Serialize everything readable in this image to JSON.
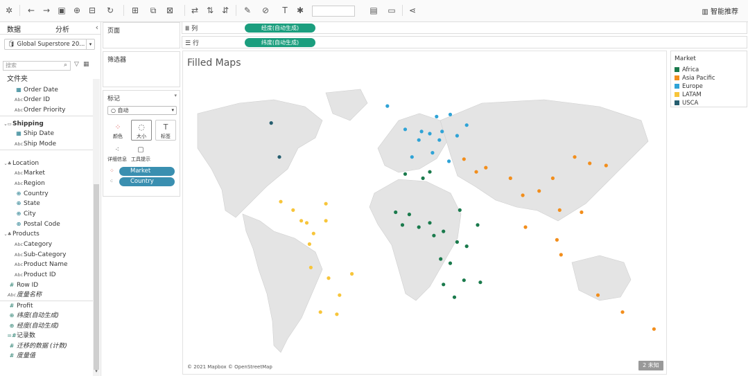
{
  "toolbar": {
    "icons": [
      "tableau-logo-icon",
      "undo-icon",
      "redo-icon",
      "save-icon",
      "new-datasource-icon",
      "pause-icon",
      "refresh-icon",
      "new-sheet-icon",
      "duplicate-icon",
      "clear-icon",
      "swap-icon",
      "sort-asc-icon",
      "sort-desc-icon",
      "highlight-icon",
      "group-icon",
      "label-icon",
      "fix-axes-icon",
      "fit-icon",
      "presentation-icon",
      "share-icon"
    ],
    "smart_label": "智能推荐"
  },
  "left_panel": {
    "tab_data": "数据",
    "tab_analytics": "分析",
    "datasource": "Global Superstore 20...",
    "search_placeholder": "搜索",
    "folder_label": "文件夹",
    "fields": [
      {
        "name": "Order Date",
        "type": "date",
        "indent": 1,
        "y": 0
      },
      {
        "name": "Order ID",
        "type": "abc",
        "indent": 1,
        "y": 14
      },
      {
        "name": "Order Priority",
        "type": "abc",
        "indent": 1,
        "y": 29
      }
    ],
    "shipping_group": "Shipping",
    "shipping_fields": [
      "Ship Date",
      "Ship Mode"
    ],
    "location_group": "Location",
    "location_fields": [
      "Market",
      "Region",
      "Country",
      "State",
      "City",
      "Postal Code"
    ],
    "products_group": "Products",
    "products_fields": [
      "Category",
      "Sub-Category",
      "Product Name",
      "Product ID"
    ],
    "row_id": "Row ID",
    "measure_names": "度量名称",
    "measures": [
      "Profit",
      "纬度(自动生成)",
      "经度(自动生成)",
      "记录数",
      "迁移的数据 (计数)",
      "度量值"
    ]
  },
  "cards": {
    "pages": "页面",
    "filters": "筛选器",
    "marks": "标记",
    "mark_type": "自动",
    "buttons": {
      "color": "颜色",
      "size": "大小",
      "label": "标签",
      "detail": "详细信息",
      "tooltip": "工具提示"
    },
    "pills": [
      "Market",
      "Country"
    ]
  },
  "shelves": {
    "columns_label": "列",
    "columns_pill": "经度(自动生成)",
    "rows_label": "行",
    "rows_pill": "纬度(自动生成)"
  },
  "viz": {
    "title": "Filled Maps",
    "attribution": "© 2021 Mapbox © OpenStreetMap",
    "unknown": "2 未知"
  },
  "legend": {
    "title": "Market",
    "items": [
      {
        "label": "Africa",
        "color": "#1a7a4c"
      },
      {
        "label": "Asia Pacific",
        "color": "#f28e1c"
      },
      {
        "label": "Europe",
        "color": "#2fa3d6"
      },
      {
        "label": "LATAM",
        "color": "#f7c53a"
      },
      {
        "label": "USCA",
        "color": "#265e6f"
      }
    ]
  },
  "chart_data": {
    "type": "scatter",
    "series": [
      {
        "name": "Africa",
        "points": [
          [
            -15,
            14
          ],
          [
            -5,
            13
          ],
          [
            2,
            7
          ],
          [
            10,
            9
          ],
          [
            20,
            5
          ],
          [
            30,
            0
          ],
          [
            37,
            -2
          ],
          [
            25,
            -10
          ],
          [
            20,
            -20
          ],
          [
            28,
            -26
          ],
          [
            32,
            15
          ],
          [
            45,
            8
          ],
          [
            5,
            30
          ],
          [
            10,
            33
          ],
          [
            -8,
            32
          ],
          [
            18,
            -8
          ],
          [
            35,
            -18
          ],
          [
            47,
            -19
          ],
          [
            -10,
            8
          ],
          [
            13,
            3
          ]
        ]
      },
      {
        "name": "Asia Pacific",
        "points": [
          [
            78,
            22
          ],
          [
            105,
            15
          ],
          [
            116,
            40
          ],
          [
            139,
            36
          ],
          [
            127,
            37
          ],
          [
            103,
            1
          ],
          [
            121,
            14
          ],
          [
            106,
            -6
          ],
          [
            133,
            -25
          ],
          [
            151,
            -33
          ],
          [
            174,
            -41
          ],
          [
            69,
            30
          ],
          [
            90,
            24
          ],
          [
            80,
            7
          ],
          [
            51,
            35
          ],
          [
            44,
            33
          ],
          [
            35,
            39
          ],
          [
            100,
            30
          ]
        ]
      },
      {
        "name": "Europe",
        "points": [
          [
            -3,
            40
          ],
          [
            2,
            48
          ],
          [
            10,
            51
          ],
          [
            12,
            42
          ],
          [
            19,
            52
          ],
          [
            15,
            59
          ],
          [
            25,
            60
          ],
          [
            37,
            55
          ],
          [
            -8,
            53
          ],
          [
            4,
            52
          ],
          [
            24,
            38
          ],
          [
            -21,
            64
          ],
          [
            30,
            50
          ],
          [
            17,
            48
          ]
        ]
      },
      {
        "name": "LATAM",
        "points": [
          [
            -99,
            19
          ],
          [
            -75,
            4
          ],
          [
            -77,
            -12
          ],
          [
            -47,
            -15
          ],
          [
            -58,
            -34
          ],
          [
            -70,
            -33
          ],
          [
            -66,
            18
          ],
          [
            -84,
            10
          ],
          [
            -90,
            15
          ],
          [
            -80,
            9
          ],
          [
            -66,
            10
          ],
          [
            -78,
            -1
          ],
          [
            -64,
            -17
          ],
          [
            -56,
            -25
          ]
        ]
      },
      {
        "name": "USCA",
        "points": [
          [
            -100,
            40
          ],
          [
            -106,
            56
          ]
        ]
      }
    ]
  }
}
